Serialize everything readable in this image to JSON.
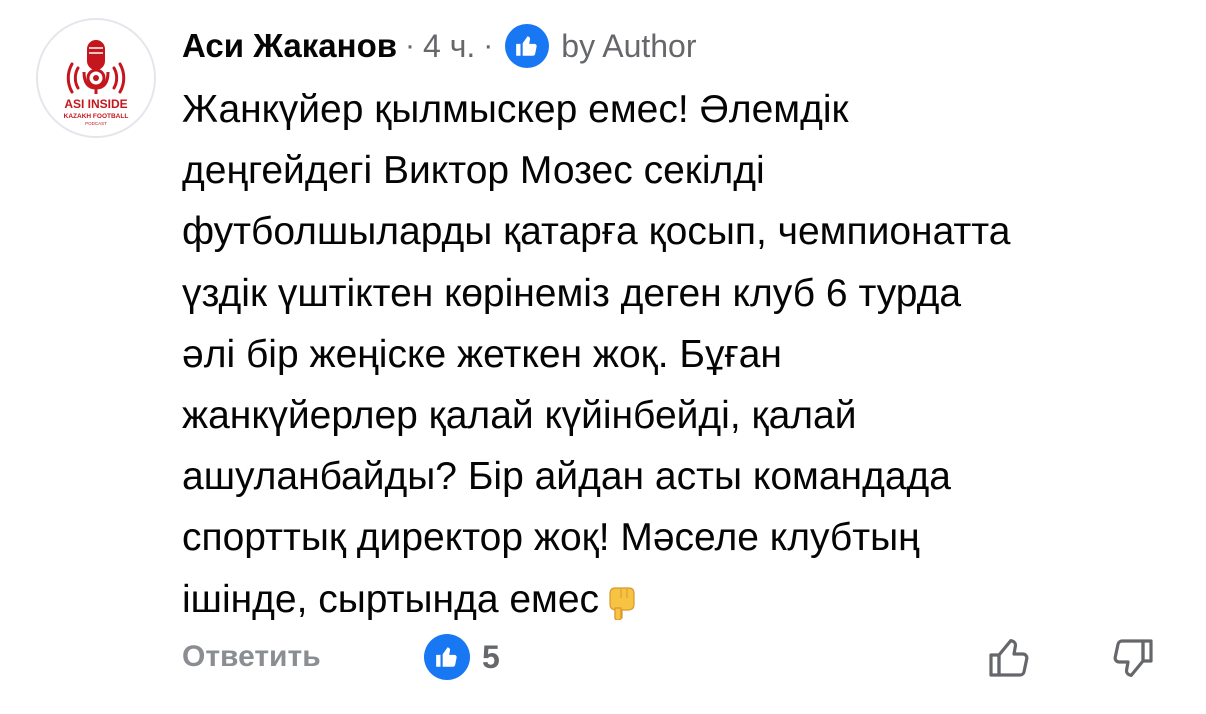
{
  "comment": {
    "avatar": {
      "brand_text": "ASI INSIDE",
      "brand_subtext": "KAZAKH FOOTBALL",
      "brand_subtext2": "PODCAST",
      "brand_color": "#c4161c"
    },
    "author": "Аси Жаканов",
    "separator": "·",
    "time": "4 ч.",
    "badge_icon": "thumbs-up-icon",
    "by_author": "by Author",
    "body_lines": [
      "Жанкүйер қылмыскер емес! Әлемдік",
      "деңгейдегі Виктор Мозес секілді",
      "футболшыларды қатарға қосып, чемпионатта",
      "үздік үштіктен көрінеміз деген клуб 6 турда",
      "әлі бір жеңіске жеткен жоқ. Бұған",
      "жанкүйерлер қалай күйінбейді, қалай",
      "ашуланбайды? Бір айдан асты командада",
      "спорттық директор жоқ! Мәселе клубтың",
      "ішінде, сыртында емес"
    ],
    "emoji": "pointing-down-emoji",
    "footer": {
      "reply_label": "Ответить",
      "reaction_icon": "thumbs-up-icon",
      "reaction_count": "5",
      "upvote_icon": "thumbs-up-outline-icon",
      "downvote_icon": "thumbs-down-outline-icon"
    }
  },
  "colors": {
    "facebook_blue": "#1877f2",
    "secondary_text": "#65676b",
    "primary_text": "#050505"
  }
}
